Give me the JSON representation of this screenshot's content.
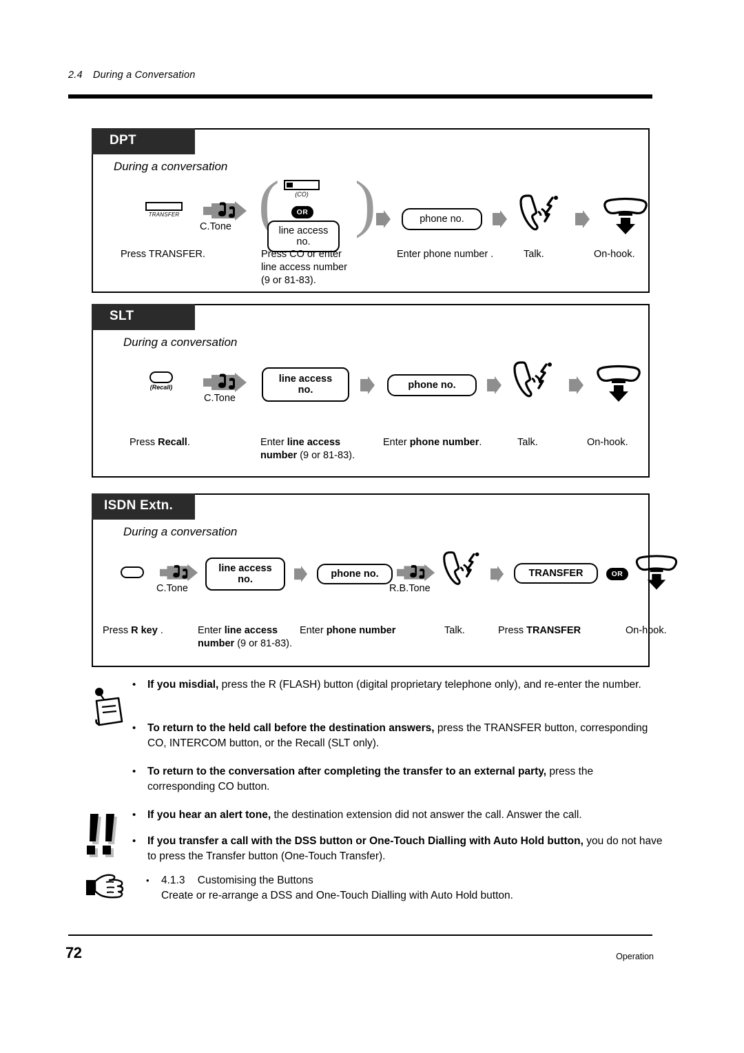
{
  "header": {
    "number": "2.4",
    "title": "During a Conversation"
  },
  "footer": {
    "page": "72",
    "label": "Operation"
  },
  "sections": [
    {
      "tab": "DPT",
      "subtitle": "During a conversation",
      "steps": [
        {
          "key_label": "TRANSFER",
          "caption": "Press TRANSFER."
        },
        {
          "tone": "C.Tone"
        },
        {
          "co_label": "(CO)",
          "or": "OR",
          "pill": "line access\nno.",
          "caption_l1": "Press CO or enter",
          "caption_l2": "line access number",
          "caption_l3": "(9 or 81-83)."
        },
        {
          "pill": "phone no.",
          "caption": "Enter phone number  ."
        },
        {
          "icon": "talk-icon",
          "caption": "Talk."
        },
        {
          "icon": "on-hook-icon",
          "caption": "On-hook."
        }
      ]
    },
    {
      "tab": "SLT",
      "subtitle": "During a conversation",
      "steps": [
        {
          "key_label": "(Recall)",
          "caption_pre": "Press ",
          "caption_bold": "Recall",
          "caption_post": "."
        },
        {
          "tone": "C.Tone"
        },
        {
          "pill": "line access\nno.",
          "caption_pre": "Enter ",
          "caption_bold": "line access",
          "caption_l2_bold": "number",
          "caption_l2_post": " (9 or 81-83)."
        },
        {
          "pill": "phone no.",
          "caption_pre": "Enter ",
          "caption_bold": "phone number",
          "caption_post": "."
        },
        {
          "icon": "talk-icon",
          "caption": "Talk."
        },
        {
          "icon": "on-hook-icon",
          "caption": "On-hook."
        }
      ]
    },
    {
      "tab": "ISDN Extn.",
      "subtitle": "During a conversation",
      "steps": [
        {
          "key_label": "",
          "caption_pre": "Press ",
          "caption_bold": "R key",
          "caption_post": " ."
        },
        {
          "tone": "C.Tone"
        },
        {
          "pill": "line access\nno.",
          "caption_pre": "Enter ",
          "caption_bold": "line access",
          "caption_l2_bold": "number",
          "caption_l2_post": " (9 or 81-83)."
        },
        {
          "pill": "phone no.",
          "caption_pre": "Enter ",
          "caption_bold": "phone number"
        },
        {
          "tone": "R.B.Tone"
        },
        {
          "icon": "talk-icon",
          "caption": "Talk."
        },
        {
          "pill": "TRANSFER",
          "or": "OR",
          "caption_pre": "Press ",
          "caption_bold": "TRANSFER"
        },
        {
          "icon": "on-hook-icon",
          "caption": "On-hook."
        }
      ]
    }
  ],
  "notes": [
    {
      "icon": "note-pin-icon",
      "bullet": "•",
      "bold": "If you misdial,",
      "rest": " press the R (FLASH) button (digital proprietary telephone only), and re-enter the number."
    },
    {
      "bullet": "•",
      "bold": "To return to the held call before the destination answers,",
      "rest": " press the TRANSFER button, corresponding CO, INTERCOM button, or the Recall (SLT only)."
    },
    {
      "bullet": "•",
      "bold": "To return to the conversation after completing the transfer to an external party,",
      "rest": " press the corresponding CO button."
    },
    {
      "bullet": "•",
      "bold": "If you hear an alert tone,",
      "rest": " the destination extension did not answer the call. Answer the call."
    },
    {
      "icon": "caution-icon",
      "bullet": "•",
      "bold": "If you transfer a call with the DSS button or One-Touch Dialling with Auto Hold button,",
      "rest": " you do not have to press the Transfer button (One-Touch Transfer)."
    },
    {
      "icon": "pointing-hand-icon",
      "bullet": "•",
      "ref_num": "4.1.3",
      "ref_title": "Customising the Buttons",
      "rest": "Create or re-arrange a DSS and One-Touch Dialling with Auto Hold button."
    }
  ],
  "colors": {
    "tab_bg": "#2b2b2b",
    "arrow_grey": "#8e8e8e",
    "rule": "#000000"
  }
}
